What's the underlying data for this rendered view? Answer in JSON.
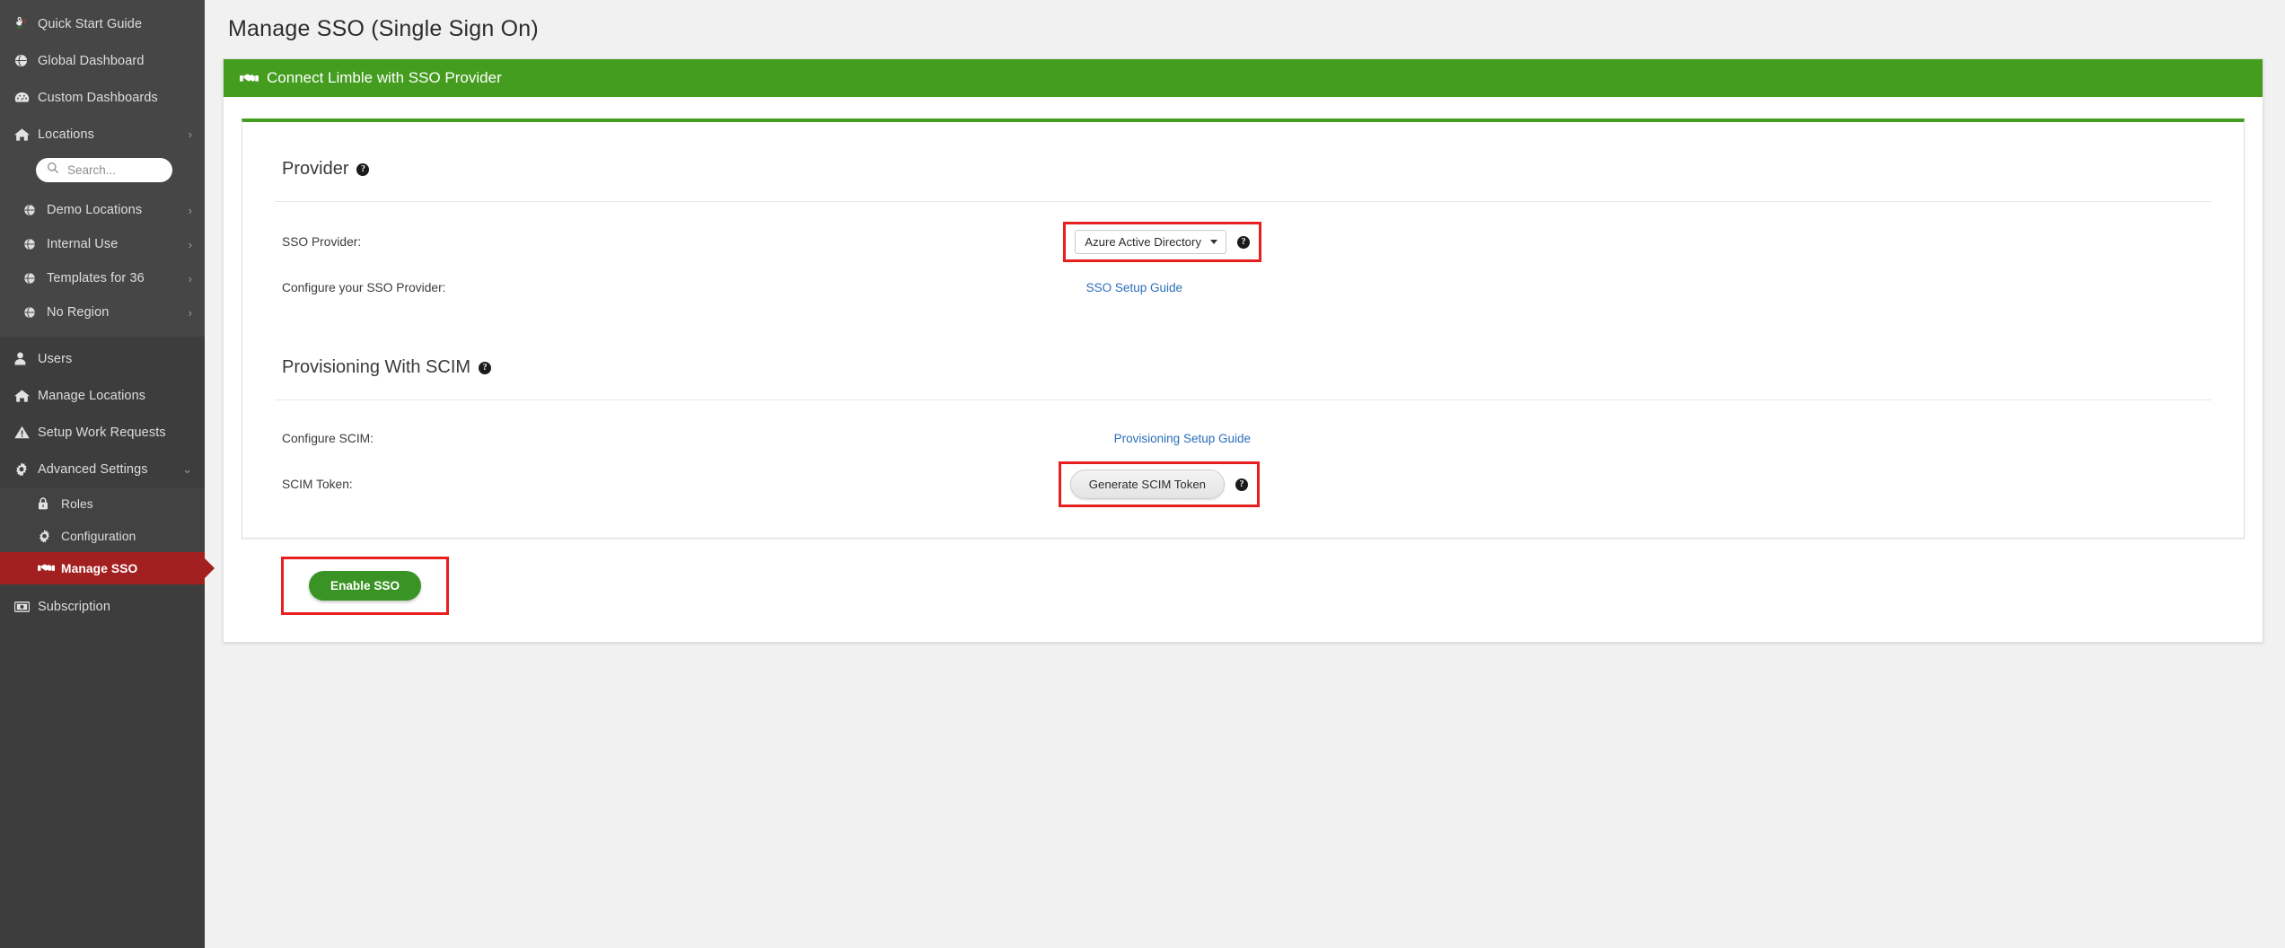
{
  "sidebar": {
    "search": {
      "placeholder": "Search...",
      "value": "",
      "icon": "search-icon"
    },
    "top_items": [
      {
        "label": "Quick Start Guide",
        "icon": "astronaut-question-icon",
        "caret": ""
      },
      {
        "label": "Global Dashboard",
        "icon": "globe-icon",
        "caret": ""
      },
      {
        "label": "Custom Dashboards",
        "icon": "gauge-icon",
        "caret": ""
      },
      {
        "label": "Locations",
        "icon": "home-icon",
        "caret": "›"
      }
    ],
    "region_items": [
      {
        "label": "Demo Locations",
        "icon": "globe-icon",
        "caret": "›"
      },
      {
        "label": "Internal Use",
        "icon": "globe-icon",
        "caret": "›"
      },
      {
        "label": "Templates for 36",
        "icon": "globe-icon",
        "caret": "›"
      },
      {
        "label": "No Region",
        "icon": "globe-icon",
        "caret": "›"
      }
    ],
    "main_items": [
      {
        "label": "Users",
        "icon": "user-icon",
        "caret": ""
      },
      {
        "label": "Manage Locations",
        "icon": "home-icon",
        "caret": ""
      },
      {
        "label": "Setup Work Requests",
        "icon": "warning-triangle-icon",
        "caret": ""
      },
      {
        "label": "Advanced Settings",
        "icon": "gear-icon",
        "caret": "⌄"
      }
    ],
    "sub_items": [
      {
        "label": "Roles",
        "icon": "lock-icon",
        "active": false
      },
      {
        "label": "Configuration",
        "icon": "gear-icon",
        "active": false
      },
      {
        "label": "Manage SSO",
        "icon": "handshake-icon",
        "active": true
      }
    ],
    "bottom_items": [
      {
        "label": "Subscription",
        "icon": "money-bill-icon",
        "caret": ""
      }
    ]
  },
  "page": {
    "title": "Manage SSO (Single Sign On)"
  },
  "panel": {
    "header_title": "Connect Limble with SSO Provider",
    "header_icon": "handshake-icon",
    "header_color": "#449d1f"
  },
  "provider_section": {
    "title": "Provider",
    "help_icon": "question-mark-icon",
    "rows": [
      {
        "label": "SSO Provider:",
        "control_type": "select",
        "selected": "Azure Active Directory",
        "options": [
          "Azure Active Directory"
        ],
        "help_icon": "question-mark-icon",
        "highlighted": true
      },
      {
        "label": "Configure your SSO Provider:",
        "control_type": "link",
        "link_text": "SSO Setup Guide",
        "highlighted": false
      }
    ]
  },
  "scim_section": {
    "title": "Provisioning With SCIM",
    "help_icon": "question-mark-icon",
    "rows": [
      {
        "label": "Configure SCIM:",
        "control_type": "link",
        "link_text": "Provisioning Setup Guide",
        "highlighted": false
      },
      {
        "label": "SCIM Token:",
        "control_type": "button",
        "button_label": "Generate SCIM Token",
        "help_icon": "question-mark-icon",
        "highlighted": true
      }
    ]
  },
  "footer": {
    "enable_button": "Enable SSO",
    "enable_button_color": "#3a9425",
    "highlighted": true
  },
  "colors": {
    "sidebar_bg": "#3d3d3d",
    "sidebar_bg_light": "#464646",
    "accent_green": "#449d1f",
    "active_red": "#a32020",
    "highlight_red": "#e81f1f",
    "link_blue": "#2a6ebb"
  }
}
